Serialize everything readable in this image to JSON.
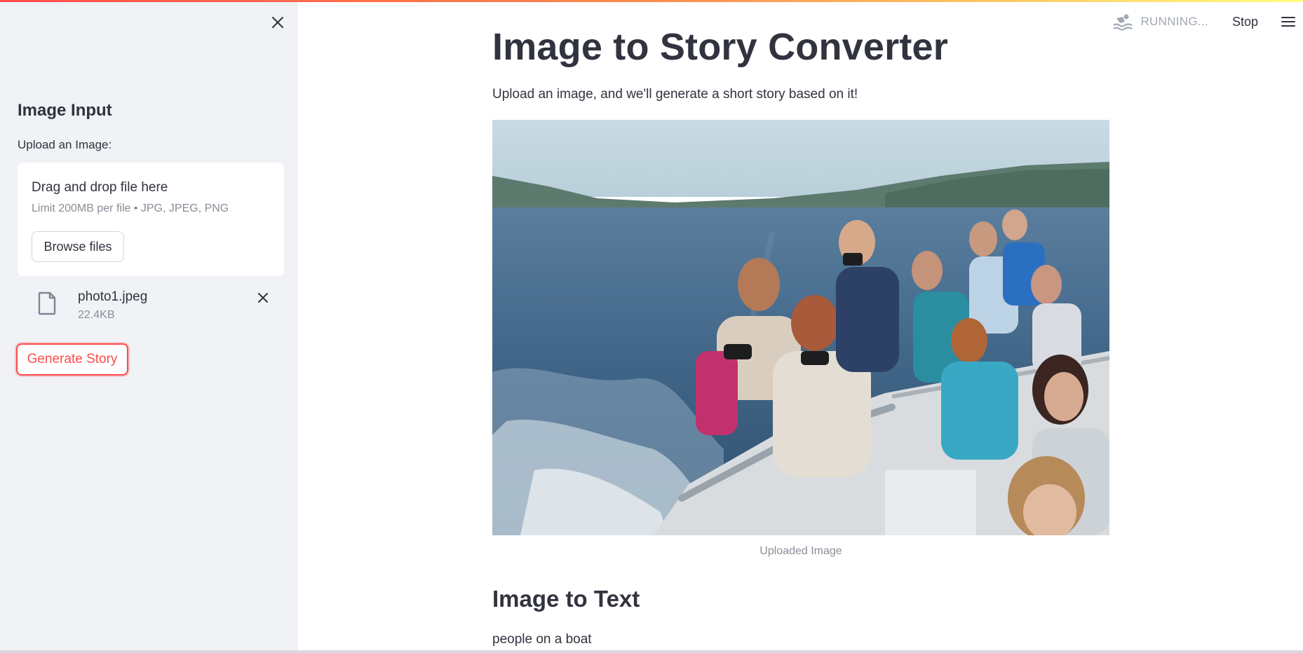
{
  "header": {
    "status_text": "RUNNING...",
    "stop_label": "Stop",
    "status_icon": "swimmer-icon",
    "menu_icon": "hamburger-menu-icon"
  },
  "sidebar": {
    "close_icon": "close-icon",
    "title": "Image Input",
    "upload_label": "Upload an Image:",
    "dropzone": {
      "title": "Drag and drop file here",
      "limit": "Limit 200MB per file • JPG, JPEG, PNG",
      "browse_label": "Browse files"
    },
    "file": {
      "name": "photo1.jpeg",
      "size": "22.4KB",
      "icon": "file-icon",
      "remove_icon": "close-icon"
    },
    "generate_label": "Generate Story"
  },
  "main": {
    "title": "Image to Story Converter",
    "intro": "Upload an image, and we'll generate a short story based on it!",
    "image_caption": "Uploaded Image",
    "section_title": "Image to Text",
    "result_text": "people on a boat"
  },
  "colors": {
    "accent": "#ff4b4b",
    "sidebar_bg": "#f0f2f6",
    "text": "#31333f",
    "muted": "#8a8d97"
  }
}
